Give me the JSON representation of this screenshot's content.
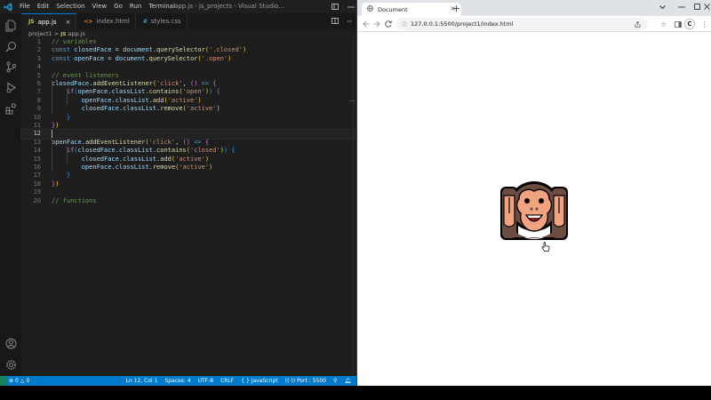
{
  "vscode": {
    "menu": [
      "File",
      "Edit",
      "Selection",
      "View",
      "Go",
      "Run",
      "Terminal"
    ],
    "window_title": "app.js - js_projects - Visual Studio...",
    "tabs": [
      {
        "icon": "JS",
        "label": "app.js",
        "active": true,
        "close": "×"
      },
      {
        "icon": "<>",
        "label": "index.html",
        "active": false
      },
      {
        "icon": "#",
        "label": "styles.css",
        "active": false
      }
    ],
    "breadcrumb": {
      "folder": "project1",
      "sep": ">",
      "icon": "JS",
      "file": "app.js"
    },
    "code": [
      [
        [
          "// variables",
          "c-com"
        ]
      ],
      [
        [
          "const ",
          "c-kw"
        ],
        [
          "closedFace",
          "c-var"
        ],
        [
          " = ",
          ""
        ],
        [
          "document",
          "c-var"
        ],
        [
          ".",
          ""
        ],
        [
          "querySelector",
          "c-fn"
        ],
        [
          "(",
          "c-br1"
        ],
        [
          "'.closed'",
          "c-str"
        ],
        [
          ")",
          "c-br1"
        ]
      ],
      [
        [
          "const ",
          "c-kw"
        ],
        [
          "openFace",
          "c-var"
        ],
        [
          " = ",
          ""
        ],
        [
          "document",
          "c-var"
        ],
        [
          ".",
          ""
        ],
        [
          "querySelector",
          "c-fn"
        ],
        [
          "(",
          "c-br1"
        ],
        [
          "'.open'",
          "c-str"
        ],
        [
          ")",
          "c-br1"
        ]
      ],
      [],
      [
        [
          "// event listeners",
          "c-com"
        ]
      ],
      [
        [
          "closedFace",
          "c-var"
        ],
        [
          ".",
          ""
        ],
        [
          "addEventListener",
          "c-fn"
        ],
        [
          "(",
          "c-br1"
        ],
        [
          "'click'",
          "c-str"
        ],
        [
          ", ",
          ""
        ],
        [
          "()",
          "c-br2"
        ],
        [
          " ",
          ""
        ],
        [
          "=>",
          "c-kw"
        ],
        [
          " ",
          ""
        ],
        [
          "{",
          "c-br2"
        ]
      ],
      [
        [
          "    ",
          ""
        ],
        [
          "if",
          "c-ctl"
        ],
        [
          "(",
          "c-br3"
        ],
        [
          "openFace",
          "c-var"
        ],
        [
          ".",
          ""
        ],
        [
          "classList",
          "c-var"
        ],
        [
          ".",
          ""
        ],
        [
          "contains",
          "c-fn"
        ],
        [
          "(",
          "c-br1"
        ],
        [
          "'open'",
          "c-str"
        ],
        [
          ")",
          "c-br1"
        ],
        [
          ")",
          "c-br3"
        ],
        [
          " ",
          ""
        ],
        [
          "{",
          "c-br3"
        ]
      ],
      [
        [
          "        ",
          ""
        ],
        [
          "openFace",
          "c-var"
        ],
        [
          ".",
          ""
        ],
        [
          "classList",
          "c-var"
        ],
        [
          ".",
          ""
        ],
        [
          "add",
          "c-fn"
        ],
        [
          "(",
          "c-br1"
        ],
        [
          "'active'",
          "c-str"
        ],
        [
          ")",
          "c-br1"
        ]
      ],
      [
        [
          "        ",
          ""
        ],
        [
          "closedFace",
          "c-var"
        ],
        [
          ".",
          ""
        ],
        [
          "classList",
          "c-var"
        ],
        [
          ".",
          ""
        ],
        [
          "remove",
          "c-fn"
        ],
        [
          "(",
          "c-br1"
        ],
        [
          "'active'",
          "c-str"
        ],
        [
          ")",
          "c-br1"
        ]
      ],
      [
        [
          "    ",
          ""
        ],
        [
          "}",
          "c-br3"
        ]
      ],
      [
        [
          "}",
          "c-br2"
        ],
        [
          ")",
          "c-br1"
        ]
      ],
      [],
      [
        [
          "openFace",
          "c-var"
        ],
        [
          ".",
          ""
        ],
        [
          "addEventListener",
          "c-fn"
        ],
        [
          "(",
          "c-br1"
        ],
        [
          "'click'",
          "c-str"
        ],
        [
          ", ",
          ""
        ],
        [
          "()",
          "c-br2"
        ],
        [
          " ",
          ""
        ],
        [
          "=>",
          "c-kw"
        ],
        [
          " ",
          ""
        ],
        [
          "{",
          "c-br2"
        ]
      ],
      [
        [
          "    ",
          ""
        ],
        [
          "if",
          "c-ctl"
        ],
        [
          "(",
          "c-br3"
        ],
        [
          "closedFace",
          "c-var"
        ],
        [
          ".",
          ""
        ],
        [
          "classList",
          "c-var"
        ],
        [
          ".",
          ""
        ],
        [
          "contains",
          "c-fn"
        ],
        [
          "(",
          "c-br1"
        ],
        [
          "'closed'",
          "c-str"
        ],
        [
          ")",
          "c-br1"
        ],
        [
          ")",
          "c-br3"
        ],
        [
          " ",
          ""
        ],
        [
          "{",
          "c-br3"
        ]
      ],
      [
        [
          "        ",
          ""
        ],
        [
          "closedFace",
          "c-var"
        ],
        [
          ".",
          ""
        ],
        [
          "classList",
          "c-var"
        ],
        [
          ".",
          ""
        ],
        [
          "add",
          "c-fn"
        ],
        [
          "(",
          "c-br1"
        ],
        [
          "'active'",
          "c-str"
        ],
        [
          ")",
          "c-br1"
        ]
      ],
      [
        [
          "        ",
          ""
        ],
        [
          "openFace",
          "c-var"
        ],
        [
          ".",
          ""
        ],
        [
          "classList",
          "c-var"
        ],
        [
          ".",
          ""
        ],
        [
          "remove",
          "c-fn"
        ],
        [
          "(",
          "c-br1"
        ],
        [
          "'active'",
          "c-str"
        ],
        [
          ")",
          "c-br1"
        ]
      ],
      [
        [
          "    ",
          ""
        ],
        [
          "}",
          "c-br3"
        ]
      ],
      [
        [
          "}",
          "c-br2"
        ],
        [
          ")",
          "c-br1"
        ]
      ],
      [],
      [
        [
          "// functions",
          "c-com"
        ]
      ]
    ],
    "current_line": 12,
    "status": {
      "errors": "0",
      "warnings": "0",
      "position": "Ln 12, Col 1",
      "spaces": "Spaces: 4",
      "encoding": "UTF-8",
      "eol": "CRLF",
      "braces": "{ }",
      "language": "JavaScript",
      "port": "Port : 5500"
    }
  },
  "browser": {
    "tab_title": "Document",
    "tab_close": "×",
    "new_tab": "+",
    "url": "127.0.0.1:5500/project1/index.html",
    "profile_initial": "C"
  },
  "colors": {
    "vscode_bg": "#1e1e1e",
    "statusbar": "#007acc",
    "accent": "#0078d4",
    "monkey_fur": "#6d4c41",
    "monkey_face": "#f1a27f"
  }
}
